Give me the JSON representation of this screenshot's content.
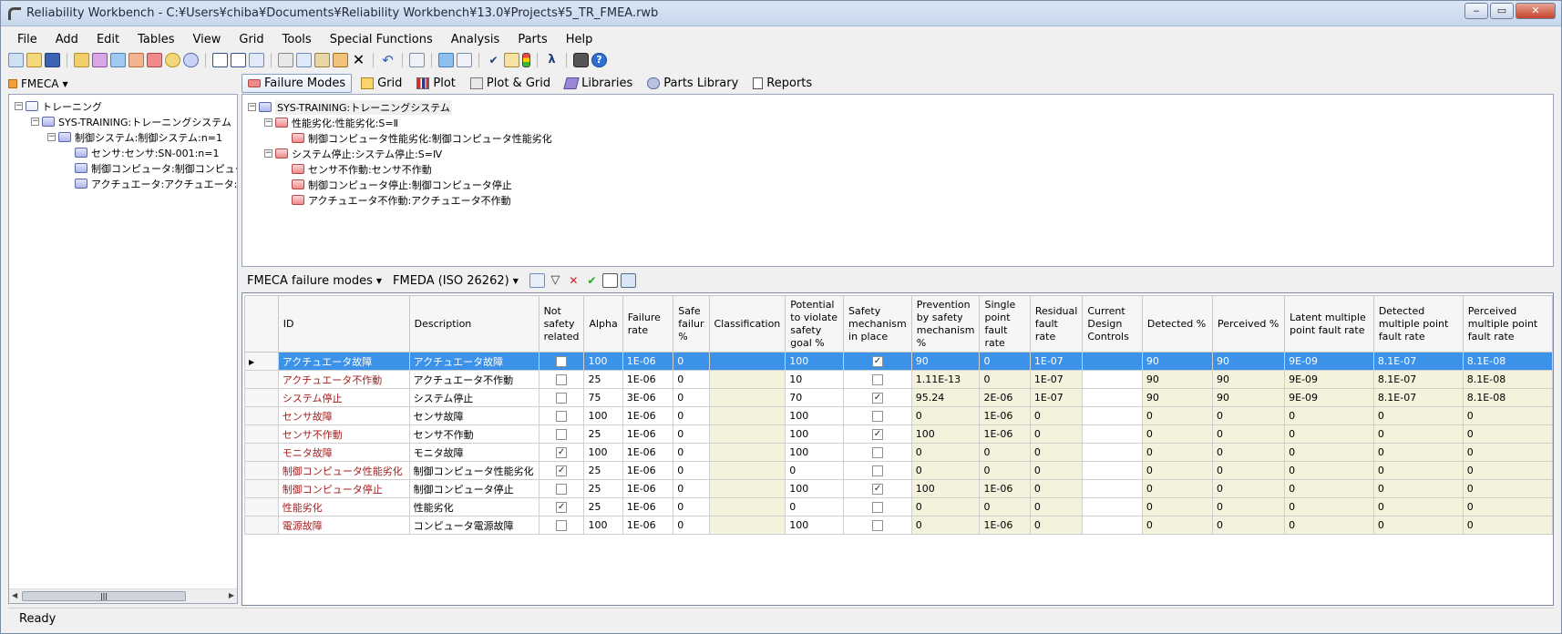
{
  "window": {
    "title": "Reliability Workbench - C:¥Users¥chiba¥Documents¥Reliability Workbench¥13.0¥Projects¥5_TR_FMEA.rwb",
    "minimize": "‒",
    "maximize": "▭",
    "close": "✕"
  },
  "menu": [
    "File",
    "Add",
    "Edit",
    "Tables",
    "View",
    "Grid",
    "Tools",
    "Special Functions",
    "Analysis",
    "Parts",
    "Help"
  ],
  "left": {
    "selector_label": "FMECA",
    "tree": [
      {
        "label": "トレーニング",
        "level": 0
      },
      {
        "label": "SYS-TRAINING:トレーニングシステム",
        "level": 1
      },
      {
        "label": "制御システム:制御システム:n=1",
        "level": 2
      },
      {
        "label": "センサ:センサ:SN-001:n=1",
        "level": 3
      },
      {
        "label": "制御コンピュータ:制御コンピュー",
        "level": 3
      },
      {
        "label": "アクチュエータ:アクチュエータ:ACT-",
        "level": 3
      }
    ]
  },
  "tabs": [
    "Failure Modes",
    "Grid",
    "Plot",
    "Plot & Grid",
    "Libraries",
    "Parts Library",
    "Reports"
  ],
  "failure_tree": [
    {
      "label": "SYS-TRAINING:トレーニングシステム",
      "level": 0,
      "expander": "−"
    },
    {
      "label": "性能劣化:性能劣化:S=Ⅱ",
      "level": 1,
      "expander": "−"
    },
    {
      "label": "制御コンピュータ性能劣化:制御コンピュータ性能劣化",
      "level": 2,
      "expander": ""
    },
    {
      "label": "システム停止:システム停止:S=Ⅳ",
      "level": 1,
      "expander": "−"
    },
    {
      "label": "センサ不作動:センサ不作動",
      "level": 2,
      "expander": ""
    },
    {
      "label": "制御コンピュータ停止:制御コンピュータ停止",
      "level": 2,
      "expander": ""
    },
    {
      "label": "アクチュエータ不作動:アクチュエータ不作動",
      "level": 2,
      "expander": ""
    }
  ],
  "grid_bar": {
    "view_label": "FMECA failure modes",
    "standard_label": "FMEDA (ISO 26262)"
  },
  "grid": {
    "columns": [
      "ID",
      "Description",
      "Not safety related",
      "Alpha",
      "Failure rate",
      "Safe failur %",
      "Classification",
      "Potential to violate safety goal %",
      "Safety mechanism in place",
      "Prevention by safety mechanism %",
      "Single point fault rate",
      "Residual fault rate",
      "Current Design Controls",
      "Detected %",
      "Perceived %",
      "Latent multiple point fault rate",
      "Detected multiple point fault rate",
      "Perceived multiple point fault rate"
    ],
    "rows": [
      {
        "id": "アクチュエータ故障",
        "desc": "アクチュエータ故障",
        "nsr": false,
        "alpha": "100",
        "fr": "1E-06",
        "safe": "0",
        "cls": "",
        "pv": "100",
        "smp": true,
        "prev": "90",
        "spfr": "0",
        "rfr": "1E-07",
        "cdc": "",
        "det": "90",
        "perc": "90",
        "lmpfr": "9E-09",
        "dmpfr": "8.1E-07",
        "pmpfr": "8.1E-08",
        "selected": true
      },
      {
        "id": "アクチュエータ不作動",
        "desc": "アクチュエータ不作動",
        "nsr": false,
        "alpha": "25",
        "fr": "1E-06",
        "safe": "0",
        "cls": "",
        "pv": "10",
        "smp": false,
        "prev": "1.11E-13",
        "spfr": "0",
        "rfr": "1E-07",
        "cdc": "",
        "det": "90",
        "perc": "90",
        "lmpfr": "9E-09",
        "dmpfr": "8.1E-07",
        "pmpfr": "8.1E-08"
      },
      {
        "id": "システム停止",
        "desc": "システム停止",
        "nsr": false,
        "alpha": "75",
        "fr": "3E-06",
        "safe": "0",
        "cls": "",
        "pv": "70",
        "smp": true,
        "prev": "95.24",
        "spfr": "2E-06",
        "rfr": "1E-07",
        "cdc": "",
        "det": "90",
        "perc": "90",
        "lmpfr": "9E-09",
        "dmpfr": "8.1E-07",
        "pmpfr": "8.1E-08"
      },
      {
        "id": "センサ故障",
        "desc": "センサ故障",
        "nsr": false,
        "alpha": "100",
        "fr": "1E-06",
        "safe": "0",
        "cls": "",
        "pv": "100",
        "smp": false,
        "prev": "0",
        "spfr": "1E-06",
        "rfr": "0",
        "cdc": "",
        "det": "0",
        "perc": "0",
        "lmpfr": "0",
        "dmpfr": "0",
        "pmpfr": "0"
      },
      {
        "id": "センサ不作動",
        "desc": "センサ不作動",
        "nsr": false,
        "alpha": "25",
        "fr": "1E-06",
        "safe": "0",
        "cls": "",
        "pv": "100",
        "smp": true,
        "prev": "100",
        "spfr": "1E-06",
        "rfr": "0",
        "cdc": "",
        "det": "0",
        "perc": "0",
        "lmpfr": "0",
        "dmpfr": "0",
        "pmpfr": "0"
      },
      {
        "id": "モニタ故障",
        "desc": "モニタ故障",
        "nsr": true,
        "alpha": "100",
        "fr": "1E-06",
        "safe": "0",
        "cls": "",
        "pv": "100",
        "smp": false,
        "prev": "0",
        "spfr": "0",
        "rfr": "0",
        "cdc": "",
        "det": "0",
        "perc": "0",
        "lmpfr": "0",
        "dmpfr": "0",
        "pmpfr": "0"
      },
      {
        "id": "制御コンピュータ性能劣化",
        "desc": "制御コンピュータ性能劣化",
        "nsr": true,
        "alpha": "25",
        "fr": "1E-06",
        "safe": "0",
        "cls": "",
        "pv": "0",
        "smp": false,
        "prev": "0",
        "spfr": "0",
        "rfr": "0",
        "cdc": "",
        "det": "0",
        "perc": "0",
        "lmpfr": "0",
        "dmpfr": "0",
        "pmpfr": "0"
      },
      {
        "id": "制御コンピュータ停止",
        "desc": "制御コンピュータ停止",
        "nsr": false,
        "alpha": "25",
        "fr": "1E-06",
        "safe": "0",
        "cls": "",
        "pv": "100",
        "smp": true,
        "prev": "100",
        "spfr": "1E-06",
        "rfr": "0",
        "cdc": "",
        "det": "0",
        "perc": "0",
        "lmpfr": "0",
        "dmpfr": "0",
        "pmpfr": "0"
      },
      {
        "id": "性能劣化",
        "desc": "性能劣化",
        "nsr": true,
        "alpha": "25",
        "fr": "1E-06",
        "safe": "0",
        "cls": "",
        "pv": "0",
        "smp": false,
        "prev": "0",
        "spfr": "0",
        "rfr": "0",
        "cdc": "",
        "det": "0",
        "perc": "0",
        "lmpfr": "0",
        "dmpfr": "0",
        "pmpfr": "0"
      },
      {
        "id": "電源故障",
        "desc": "コンピュータ電源故障",
        "nsr": false,
        "alpha": "100",
        "fr": "1E-06",
        "safe": "0",
        "cls": "",
        "pv": "100",
        "smp": false,
        "prev": "0",
        "spfr": "1E-06",
        "rfr": "0",
        "cdc": "",
        "det": "0",
        "perc": "0",
        "lmpfr": "0",
        "dmpfr": "0",
        "pmpfr": "0"
      }
    ]
  },
  "status": "Ready",
  "colors": {
    "selection": "#3b92e8",
    "id_text": "#a31f1f",
    "beige_cell": "#f4f1dc"
  }
}
